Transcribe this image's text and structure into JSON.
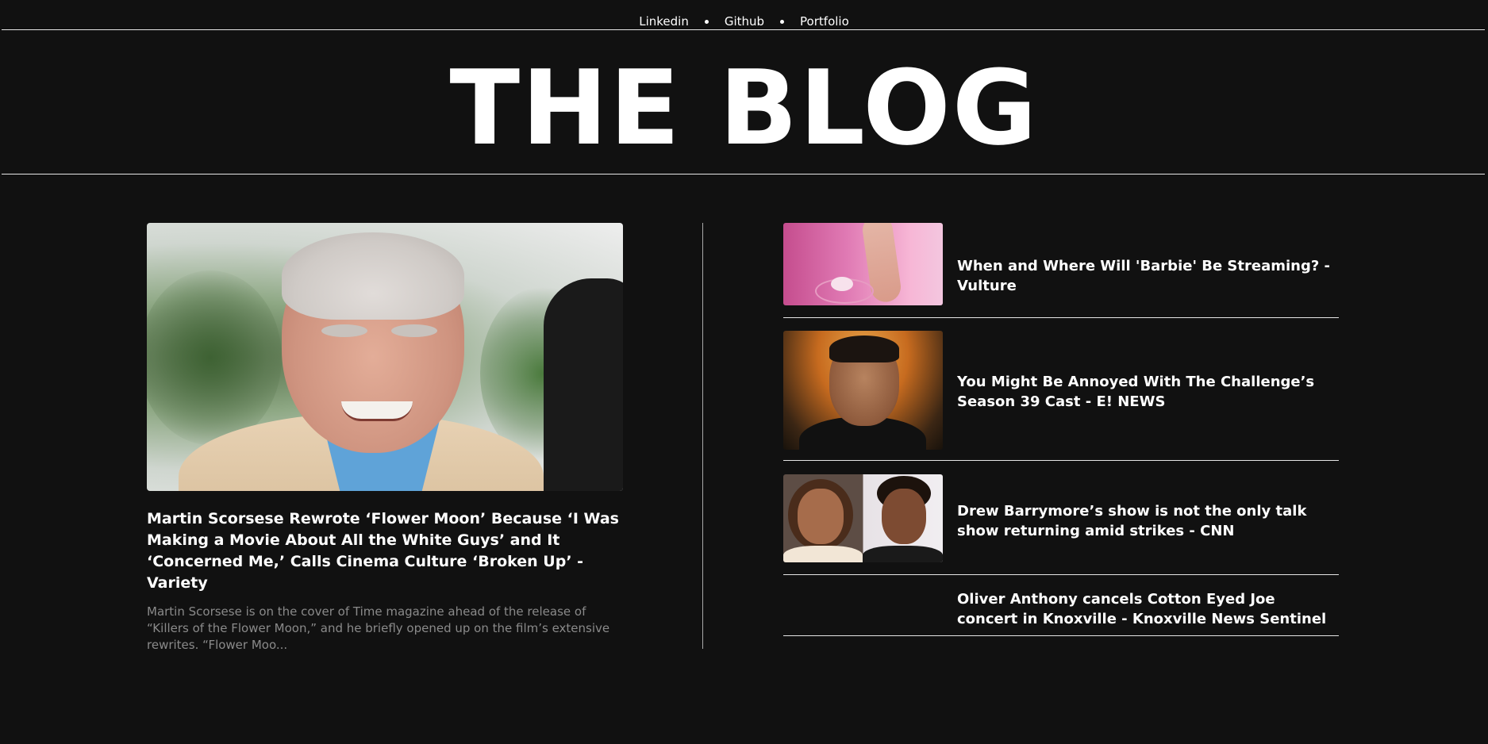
{
  "nav": {
    "links": [
      "Linkedin",
      "Github",
      "Portfolio"
    ]
  },
  "header": {
    "title": "THE BLOG"
  },
  "featured": {
    "image_alt": "Martin Scorsese smiling",
    "title": "Martin Scorsese Rewrote ‘Flower Moon’ Because ‘I Was Making a Movie About All the White Guys’ and It ‘Concerned Me,’ Calls Cinema Culture ‘Broken Up’ - Variety",
    "excerpt": "Martin Scorsese is on the cover of Time magazine ahead of the release of “Killers of the Flower Moon,” and he briefly opened up on the film’s extensive rewrites. “Flower Moo..."
  },
  "side_articles": [
    {
      "title": "When and Where Will 'Barbie' Be Streaming? - Vulture",
      "thumbnail": "barbie-thumbnail"
    },
    {
      "title": "You Might Be Annoyed With The Challenge’s Season 39 Cast - E! NEWS",
      "thumbnail": "challenge-thumbnail"
    },
    {
      "title": "Drew Barrymore’s show is not the only talk show returning amid strikes - CNN",
      "thumbnail": "cnn-thumbnail"
    },
    {
      "title": "Oliver Anthony cancels Cotton Eyed Joe concert in Knoxville - Knoxville News Sentinel",
      "thumbnail": ""
    }
  ],
  "colors": {
    "background": "#111111",
    "text": "#ffffff",
    "muted": "#8a8a8a",
    "rule": "#e6e6e6"
  }
}
